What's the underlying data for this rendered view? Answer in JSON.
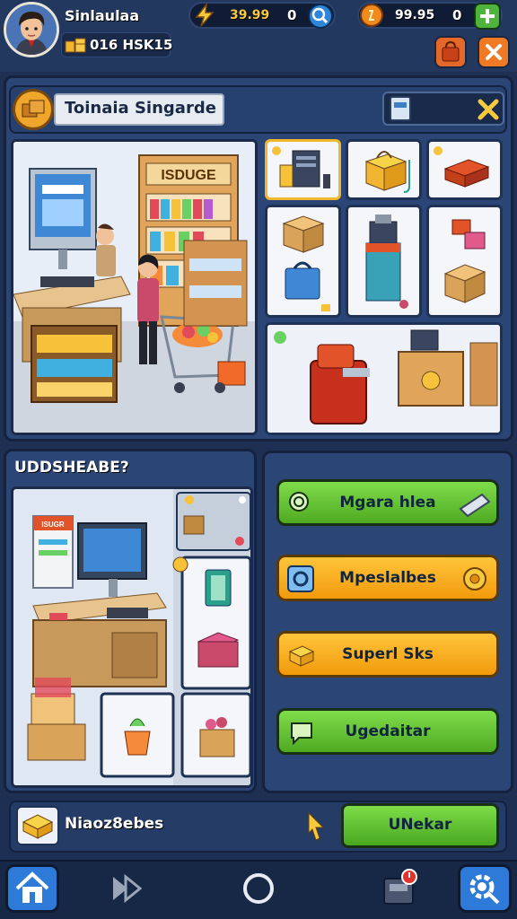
{
  "player": {
    "name": "Sinlaulaa",
    "id_text": "016 HSK15"
  },
  "currencies": [
    {
      "value": "39.99",
      "count": "0",
      "icon": "lightning-icon",
      "color": "#f7c93c"
    },
    {
      "value": "99.95",
      "count": "0",
      "icon": "coin-icon",
      "color": "#f7c93c"
    }
  ],
  "store_panel": {
    "title": "Toinaia Singarde",
    "shelf_sign": "ISDUGE",
    "tile_icons": [
      "computer-supplies-icon",
      "gold-box-icon",
      "red-case-icon",
      "cardboard-box-icon",
      "vending-machine-icon",
      "toy-blocks-icon",
      "checkout-counter-icon"
    ]
  },
  "upgrade_panel": {
    "title": "UDDSHEABE?",
    "sign": "ISUGR"
  },
  "menu": {
    "buttons": [
      {
        "label": "Mgara hlea",
        "style": "green",
        "icon": "magnifier-icon"
      },
      {
        "label": "Mpeslalbes",
        "style": "orange",
        "icon": "gear-icon"
      },
      {
        "label": "Superl Sks",
        "style": "orange",
        "icon": "box-icon"
      },
      {
        "label": "Ugedaitar",
        "style": "green",
        "icon": "chat-icon"
      }
    ]
  },
  "footer": {
    "item_label": "Niaoz8ebes",
    "unlock_label": "UNekar"
  },
  "nav": [
    "home-icon",
    "forward-icon",
    "circle-icon",
    "shop-icon",
    "settings-icon"
  ],
  "colors": {
    "background": "#1d2f52",
    "panel": "#2b4676",
    "accent_orange": "#f29a0c",
    "accent_green": "#4faa22"
  }
}
